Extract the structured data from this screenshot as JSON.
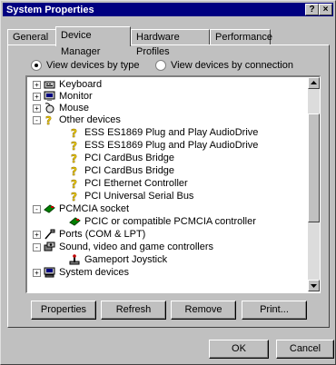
{
  "window": {
    "title": "System Properties",
    "help_label": "?",
    "close_label": "×"
  },
  "tabs": [
    {
      "label": "General"
    },
    {
      "label": "Device Manager",
      "active": true
    },
    {
      "label": "Hardware Profiles"
    },
    {
      "label": "Performance"
    }
  ],
  "view_options": {
    "by_type_label": "View devices by type",
    "by_connection_label": "View devices by connection",
    "selected": "by_type"
  },
  "tree": [
    {
      "expander": "+",
      "icon": "keyboard-icon",
      "label": "Keyboard"
    },
    {
      "expander": "+",
      "icon": "monitor-icon",
      "label": "Monitor"
    },
    {
      "expander": "+",
      "icon": "mouse-icon",
      "label": "Mouse"
    },
    {
      "expander": "-",
      "icon": "question-mark-icon",
      "label": "Other devices"
    },
    {
      "icon": "question-mark-icon",
      "label": "ESS ES1869 Plug and Play AudioDrive"
    },
    {
      "icon": "question-mark-icon",
      "label": "ESS ES1869 Plug and Play AudioDrive"
    },
    {
      "icon": "question-mark-icon",
      "label": "PCI CardBus Bridge"
    },
    {
      "icon": "question-mark-icon",
      "label": "PCI CardBus Bridge"
    },
    {
      "icon": "question-mark-icon",
      "label": "PCI Ethernet Controller"
    },
    {
      "icon": "question-mark-icon",
      "label": "PCI Universal Serial Bus"
    },
    {
      "expander": "-",
      "icon": "pcmcia-icon",
      "label": "PCMCIA socket"
    },
    {
      "icon": "pcmcia-icon",
      "label": "PCIC or compatible PCMCIA controller"
    },
    {
      "expander": "+",
      "icon": "port-icon",
      "label": "Ports (COM & LPT)"
    },
    {
      "expander": "-",
      "icon": "sound-icon",
      "label": "Sound, video and game controllers"
    },
    {
      "icon": "joystick-icon",
      "label": "Gameport Joystick"
    },
    {
      "expander": "+",
      "icon": "computer-icon",
      "label": "System devices"
    }
  ],
  "buttons": {
    "properties": "Properties",
    "refresh": "Refresh",
    "remove": "Remove",
    "print": "Print...",
    "ok": "OK",
    "cancel": "Cancel"
  },
  "colors": {
    "titlebar": "#000080",
    "face": "#c0c0c0"
  }
}
